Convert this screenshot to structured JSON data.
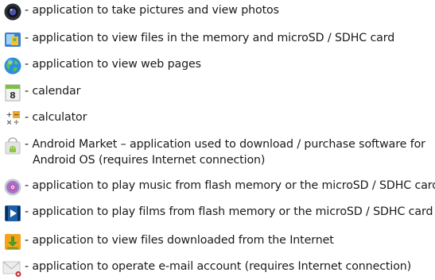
{
  "items": [
    {
      "icon": "camera-icon",
      "text": "- application to take pictures and view photos"
    },
    {
      "icon": "file-manager-icon",
      "text": "- application to view files in the memory and microSD / SDHC card"
    },
    {
      "icon": "browser-globe-icon",
      "text": "- application to view web pages"
    },
    {
      "icon": "calendar-icon",
      "icon_text": "8",
      "text": "- calendar"
    },
    {
      "icon": "calculator-icon",
      "icon_text": [
        "+",
        "−",
        "×",
        "÷"
      ],
      "text": "- calculator"
    },
    {
      "icon": "android-market-icon",
      "text": "- Android Market – application used to download / purchase software for",
      "text2": "Android OS (requires Internet connection)"
    },
    {
      "icon": "music-disc-icon",
      "text": "- application to play music from flash memory or the microSD / SDHC card"
    },
    {
      "icon": "video-player-icon",
      "text": "- application to play films from flash memory or the microSD / SDHC card"
    },
    {
      "icon": "downloads-icon",
      "text": "- application to view files downloaded from the Internet"
    },
    {
      "icon": "email-icon",
      "text": "-  application to operate e-mail account (requires Internet connection)"
    }
  ]
}
